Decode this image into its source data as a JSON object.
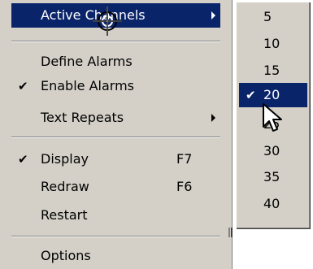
{
  "main_menu": {
    "active_channels": "Active Channels",
    "define_alarms": "Define Alarms",
    "enable_alarms": "Enable Alarms",
    "text_repeats": "Text Repeats",
    "display": "Display",
    "display_accel": "F7",
    "redraw": "Redraw",
    "redraw_accel": "F6",
    "restart": "Restart",
    "options": "Options"
  },
  "channels_submenu": {
    "items": [
      "5",
      "10",
      "15",
      "20",
      "25",
      "30",
      "35",
      "40"
    ],
    "selected": "20"
  },
  "icons": {
    "check": "✔",
    "crosshair": "crosshair-icon",
    "cursor": "arrow-cursor-icon"
  },
  "colors": {
    "menu_bg": "#d4d0c8",
    "highlight": "#0a246a"
  }
}
